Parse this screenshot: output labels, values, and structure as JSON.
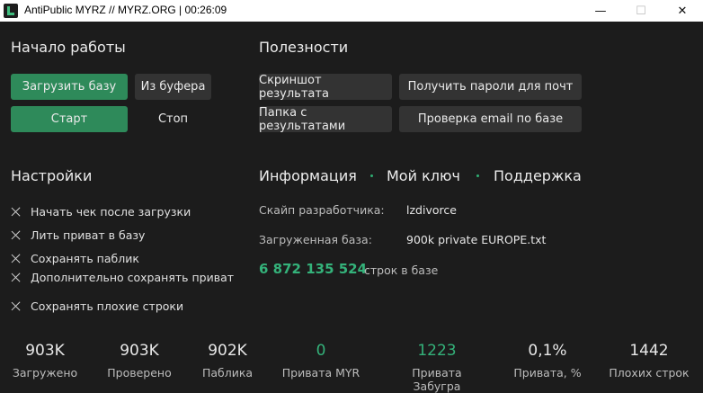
{
  "window": {
    "title": "AntiPublic MYRZ // MYRZ.ORG | 00:26:09",
    "minimize": "—",
    "maximize": "☐",
    "close": "✕"
  },
  "start_section": {
    "heading": "Начало работы",
    "load_base": "Загрузить базу",
    "from_buffer": "Из буфера",
    "start": "Старт",
    "stop": "Стоп"
  },
  "utilities": {
    "heading": "Полезности",
    "screenshot": "Скриншот результата",
    "get_passwords": "Получить пароли для почт",
    "results_folder": "Папка с результатами",
    "email_check": "Проверка email по базе"
  },
  "settings": {
    "heading": "Настройки",
    "items": [
      "Начать чек после загрузки",
      "Лить приват в базу",
      "Сохранять паблик",
      "Дополнительно сохранять приват",
      "Сохранять плохие строки"
    ]
  },
  "info": {
    "tabs": [
      "Информация",
      "Мой ключ",
      "Поддержка"
    ],
    "dev_skype_label": "Скайп разработчика:",
    "dev_skype_value": "lzdivorce",
    "loaded_base_label": "Загруженная база:",
    "loaded_base_value": "900k private EUROPE.txt",
    "rows_count": "6 872 135 524",
    "rows_label": "строк в базе"
  },
  "stats": [
    {
      "value": "903K",
      "label": "Загружено"
    },
    {
      "value": "903K",
      "label": "Проверено"
    },
    {
      "value": "902K",
      "label": "Паблика"
    },
    {
      "value": "0",
      "label": "Привата MYR"
    },
    {
      "value": "1223",
      "label": "Привата Забугра"
    },
    {
      "value": "0,1%",
      "label": "Привата, %"
    },
    {
      "value": "1442",
      "label": "Плохих строк"
    }
  ],
  "colors": {
    "accent": "#2e8a5a",
    "accent_text": "#34b27a",
    "background": "#1c1c1c"
  }
}
